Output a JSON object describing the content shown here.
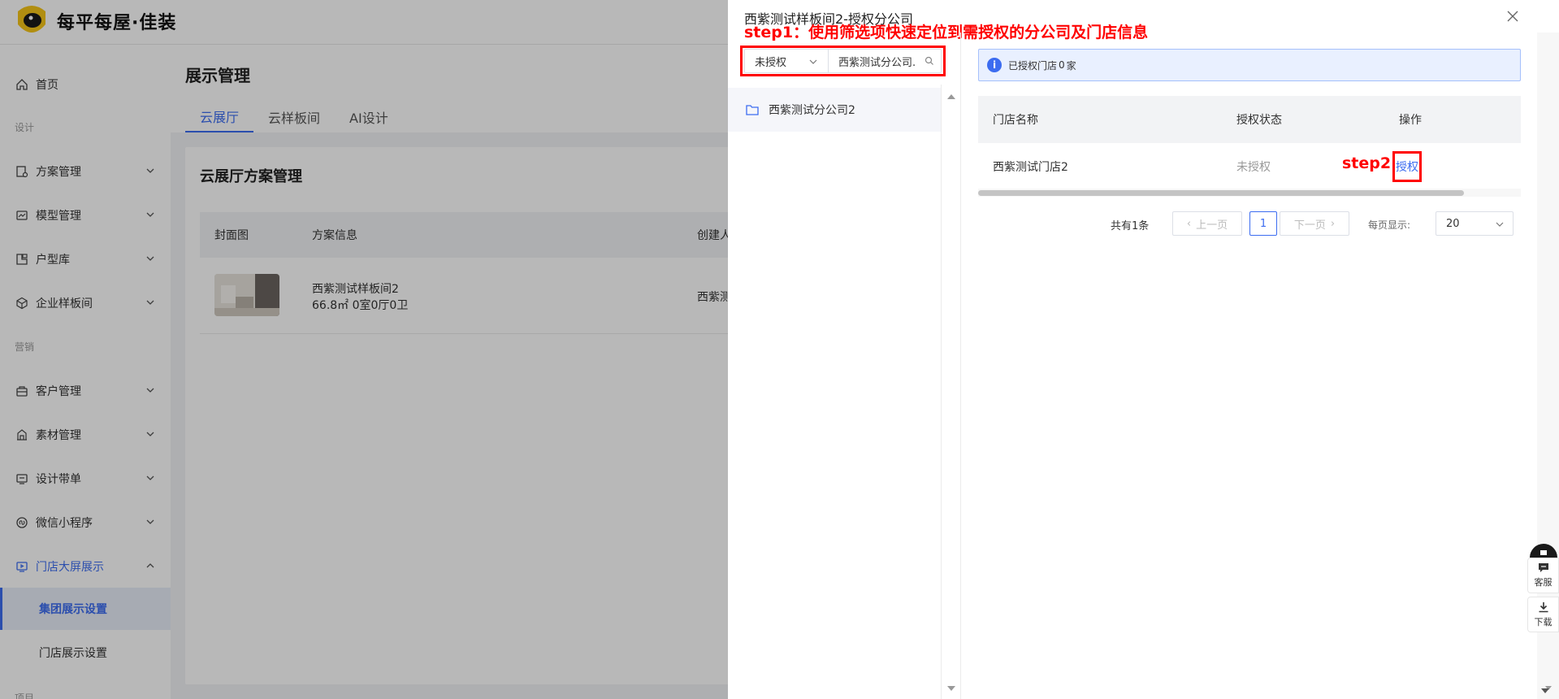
{
  "brand": {
    "name": "每平每屋·佳装"
  },
  "sidebar": {
    "home": "首页",
    "section_design": "设计",
    "items_design": [
      "方案管理",
      "模型管理",
      "户型库",
      "企业样板间"
    ],
    "section_marketing": "营销",
    "items_marketing": [
      "客户管理",
      "素材管理",
      "设计带单",
      "微信小程序"
    ],
    "store_screen": "门店大屏展示",
    "sub_group": "集团展示设置",
    "sub_store": "门店展示设置",
    "section_project": "项目"
  },
  "page": {
    "title": "展示管理",
    "tabs": [
      "云展厅",
      "云样板间",
      "AI设计"
    ],
    "card_title": "云展厅方案管理",
    "columns": [
      "封面图",
      "方案信息",
      "创建人"
    ],
    "row": {
      "name": "西紫测试样板间2",
      "meta": "66.8㎡ 0室0厅0卫",
      "creator": "西紫测"
    }
  },
  "drawer": {
    "title": "西紫测试样板间2-授权分公司",
    "filter_select": "未授权",
    "filter_input": "西紫测试分公司.",
    "tree_items": [
      "西紫测试分公司2"
    ],
    "info_prefix": "已授权门店",
    "info_count": "0",
    "info_suffix": "家",
    "table": {
      "headers": [
        "门店名称",
        "授权状态",
        "操作"
      ],
      "rows": [
        {
          "store": "西紫测试门店2",
          "status": "未授权",
          "action": "授权"
        }
      ]
    },
    "pager": {
      "total": "共有1条",
      "prev": "上一页",
      "page": "1",
      "next": "下一页",
      "per_page_label": "每页显示:",
      "per_page": "20"
    }
  },
  "annotations": {
    "step1": "step1：使用筛选项快速定位到需授权的分公司及门店信息",
    "step2": "step2"
  },
  "float": {
    "service": "客服",
    "download": "下载"
  },
  "colors": {
    "accent": "#3c6cf0",
    "annotation": "#ff0000"
  }
}
